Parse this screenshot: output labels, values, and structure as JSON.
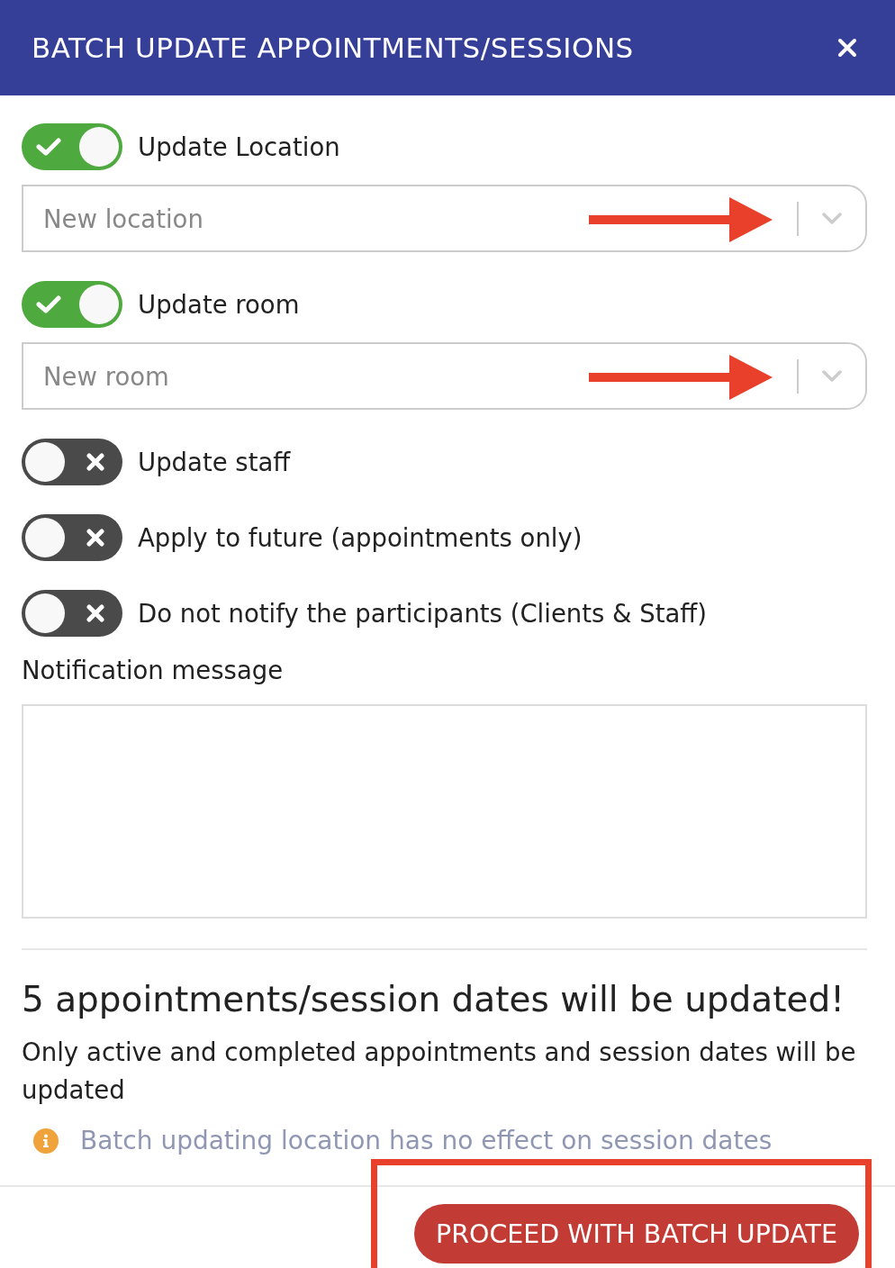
{
  "dialog": {
    "title": "BATCH UPDATE APPOINTMENTS/SESSIONS"
  },
  "options": [
    {
      "kind": "toggle",
      "label": "Update Location",
      "on": true
    },
    {
      "kind": "select",
      "placeholder": "New location",
      "pointer_arrow": true
    },
    {
      "kind": "toggle",
      "label": "Update room",
      "on": true
    },
    {
      "kind": "select",
      "placeholder": "New room",
      "pointer_arrow": true
    },
    {
      "kind": "toggle",
      "label": "Update staff",
      "on": false
    },
    {
      "kind": "toggle",
      "label": "Apply to future (appointments only)",
      "on": false
    },
    {
      "kind": "toggle",
      "label": "Do not notify the participants (Clients & Staff)",
      "on": false
    }
  ],
  "notification": {
    "label": "Notification message"
  },
  "summary": {
    "heading": "5 appointments/session dates will be updated!",
    "text": "Only active and completed appointments and session dates will be updated",
    "note": "Batch updating location has no effect on session dates"
  },
  "footer": {
    "button": {
      "label": "PROCEED WITH BATCH UPDATE",
      "highlighted": true
    }
  }
}
